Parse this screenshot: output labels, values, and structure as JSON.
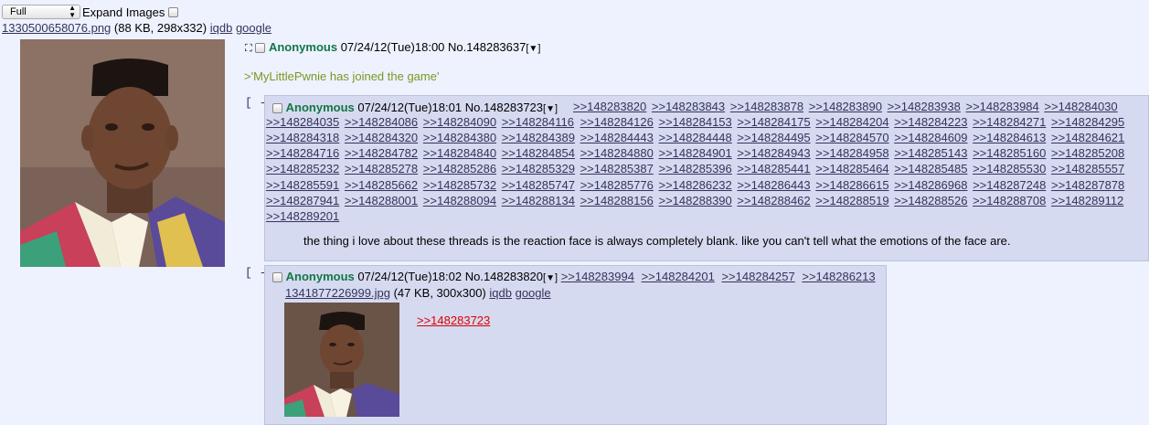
{
  "controls": {
    "image_mode": "Full",
    "expand_label": "Expand Images"
  },
  "op": {
    "file_name": "1330500658076.png",
    "file_info": "(88 KB, 298x332)",
    "iqdb": "iqdb",
    "google": "google",
    "name": "Anonymous",
    "datetime": "07/24/12(Tue)18:00",
    "post_no": "No.148283637",
    "greentext": ">'MyLittlePwnie has joined the game'"
  },
  "reply1": {
    "collapse": "[ - ]",
    "name": "Anonymous",
    "datetime": "07/24/12(Tue)18:01",
    "post_no": "No.148283723",
    "backlinks": [
      ">>148283820",
      ">>148283843",
      ">>148283878",
      ">>148283890",
      ">>148283938",
      ">>148283984",
      ">>148284030",
      ">>148284035",
      ">>148284086",
      ">>148284090",
      ">>148284116",
      ">>148284126",
      ">>148284153",
      ">>148284175",
      ">>148284204",
      ">>148284223",
      ">>148284271",
      ">>148284295",
      ">>148284318",
      ">>148284320",
      ">>148284380",
      ">>148284389",
      ">>148284443",
      ">>148284448",
      ">>148284495",
      ">>148284570",
      ">>148284609",
      ">>148284613",
      ">>148284621",
      ">>148284716",
      ">>148284782",
      ">>148284840",
      ">>148284854",
      ">>148284880",
      ">>148284901",
      ">>148284943",
      ">>148284958",
      ">>148285143",
      ">>148285160",
      ">>148285208",
      ">>148285232",
      ">>148285278",
      ">>148285286",
      ">>148285329",
      ">>148285387",
      ">>148285396",
      ">>148285441",
      ">>148285464",
      ">>148285485",
      ">>148285530",
      ">>148285557",
      ">>148285591",
      ">>148285662",
      ">>148285732",
      ">>148285747",
      ">>148285776",
      ">>148286232",
      ">>148286443",
      ">>148286615",
      ">>148286968",
      ">>148287248",
      ">>148287878",
      ">>148287941",
      ">>148288001",
      ">>148288094",
      ">>148288134",
      ">>148288156",
      ">>148288390",
      ">>148288462",
      ">>148288519",
      ">>148288526",
      ">>148288708",
      ">>148289112",
      ">>148289201"
    ],
    "text": "the thing i love about these threads is the reaction face is always completely blank. like you can't tell what the emotions of the face are."
  },
  "reply2": {
    "collapse": "[ - ]",
    "name": "Anonymous",
    "datetime": "07/24/12(Tue)18:02",
    "post_no": "No.148283820",
    "backlinks": [
      ">>148283994",
      ">>148284201",
      ">>148284257",
      ">>148286213"
    ],
    "file_name": "1341877226999.jpg",
    "file_info": "(47 KB, 300x300)",
    "iqdb": "iqdb",
    "google": "google",
    "quote": ">>148283723"
  },
  "colors": {
    "background": "#eef2ff",
    "reply_bg": "#d6daf0",
    "name": "#117743",
    "greentext": "#789922",
    "link": "#34345c",
    "quote_link": "#dd0000"
  }
}
